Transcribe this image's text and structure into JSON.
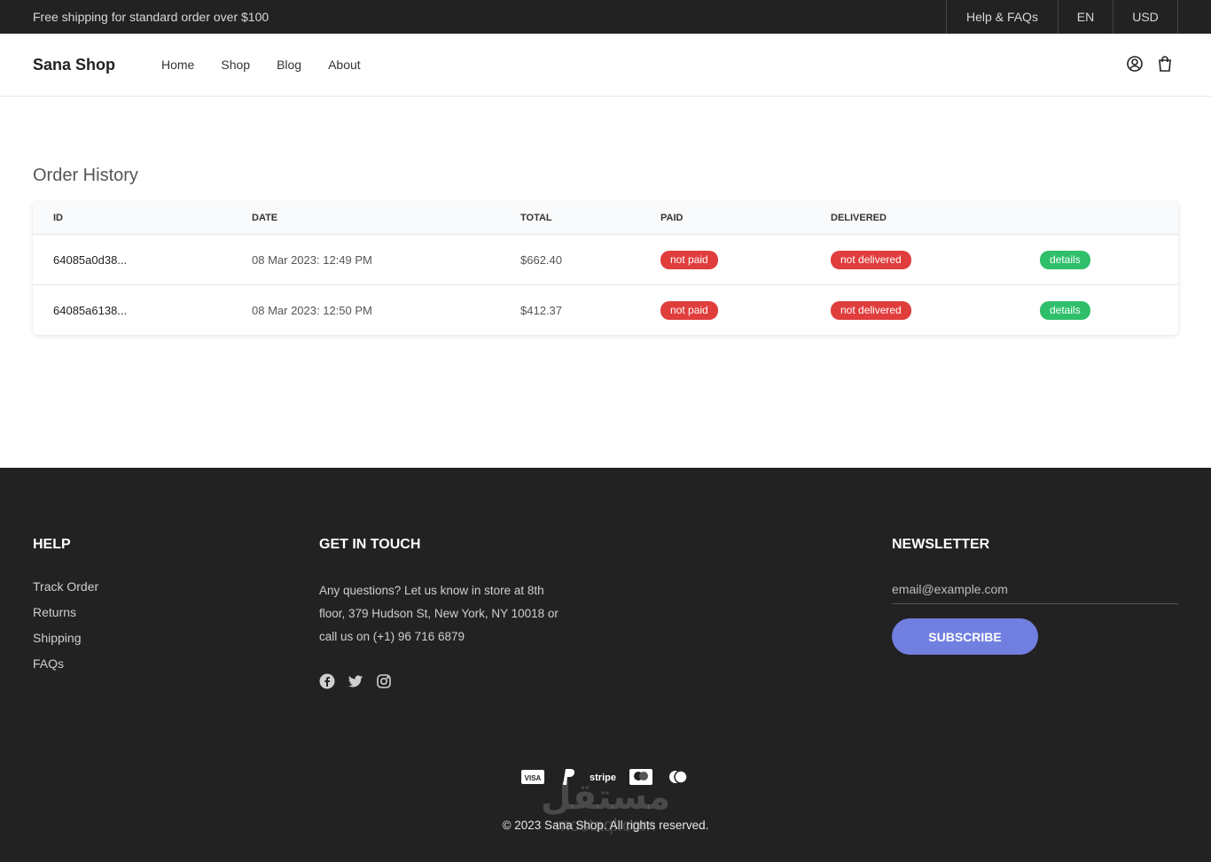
{
  "topbar": {
    "shipping_text": "Free shipping for standard order over $100",
    "help_label": "Help & FAQs",
    "language": "EN",
    "currency": "USD"
  },
  "header": {
    "logo": "Sana Shop",
    "nav": [
      "Home",
      "Shop",
      "Blog",
      "About"
    ],
    "icons": [
      "user-icon",
      "bag-icon"
    ]
  },
  "main": {
    "title": "Order History",
    "columns": [
      "ID",
      "DATE",
      "TOTAL",
      "PAID",
      "DELIVERED"
    ],
    "orders": [
      {
        "id": "64085a0d38...",
        "date": "08 Mar 2023: 12:49 PM",
        "total": "$662.40",
        "paid": "not paid",
        "delivered": "not delivered",
        "action": "details"
      },
      {
        "id": "64085a6138...",
        "date": "08 Mar 2023: 12:50 PM",
        "total": "$412.37",
        "paid": "not paid",
        "delivered": "not delivered",
        "action": "details"
      }
    ],
    "colors": {
      "badge_red": "#e03d3d",
      "badge_green": "#2fbf6a"
    }
  },
  "footer": {
    "help": {
      "title": "HELP",
      "links": [
        "Track Order",
        "Returns",
        "Shipping",
        "FAQs"
      ]
    },
    "touch": {
      "title": "GET IN TOUCH",
      "text": "Any questions? Let us know in store at 8th floor, 379 Hudson St, New York, NY 10018 or call us on (+1) 96 716 6879",
      "socials": [
        "facebook-icon",
        "twitter-icon",
        "instagram-icon"
      ]
    },
    "newsletter": {
      "title": "NEWSLETTER",
      "placeholder": "email@example.com",
      "button": "SUBSCRIBE"
    },
    "payments": [
      "visa-icon",
      "paypal-icon",
      "stripe-icon",
      "mastercard-icon",
      "maestro-icon"
    ],
    "payment_labels": {
      "visa": "VISA",
      "stripe": "stripe"
    },
    "copyright": "© 2023 Sana Shop. All rights reserved.",
    "watermark": {
      "line1": "مستقل",
      "line2": "mostaql.com"
    },
    "accent": "#717fe0",
    "background": "#222222"
  }
}
